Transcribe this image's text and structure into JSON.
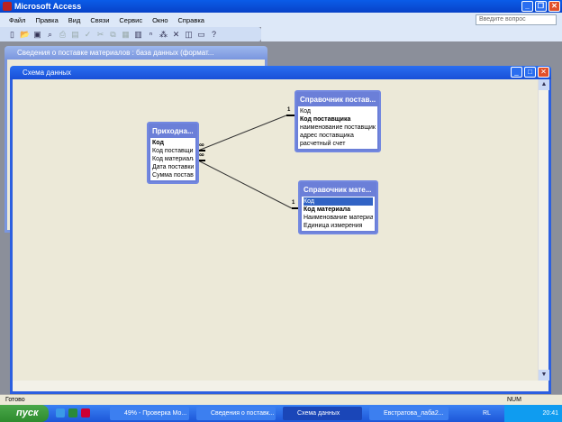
{
  "app": {
    "title": "Microsoft Access",
    "ask_placeholder": "Введите вопрос"
  },
  "menu": [
    "Файл",
    "Правка",
    "Вид",
    "Связи",
    "Сервис",
    "Окно",
    "Справка"
  ],
  "back_window": {
    "title": "Сведения о поставке материалов : база данных (формат..."
  },
  "schema_window": {
    "title": "Схема данных"
  },
  "tables": [
    {
      "title": "Приходна...",
      "fields": [
        "Код",
        "Код поставщика",
        "Код материала",
        "Дата поставки",
        "Сумма поставки"
      ],
      "bold": [
        0
      ]
    },
    {
      "title": "Справочник постав...",
      "fields": [
        "Код",
        "Код поставщика",
        "наименование поставщика",
        "адрес поставщика",
        "расчетный счет"
      ],
      "bold": [
        1
      ]
    },
    {
      "title": "Справочник мате...",
      "fields": [
        "Код",
        "Код материала",
        "Наименование материала",
        "Единица измерения"
      ],
      "bold": [
        1
      ],
      "selected": 0
    }
  ],
  "relations": {
    "one": "1",
    "many": "∞"
  },
  "status": {
    "text": "Готово",
    "num": "NUM"
  },
  "taskbar": {
    "start": "пуск",
    "tasks": [
      "49% - Проверка Мо...",
      "Сведения о поставк...",
      "Схема данных",
      "Евстратова_лаба2..."
    ],
    "lang": "RL",
    "time": "20:41"
  }
}
